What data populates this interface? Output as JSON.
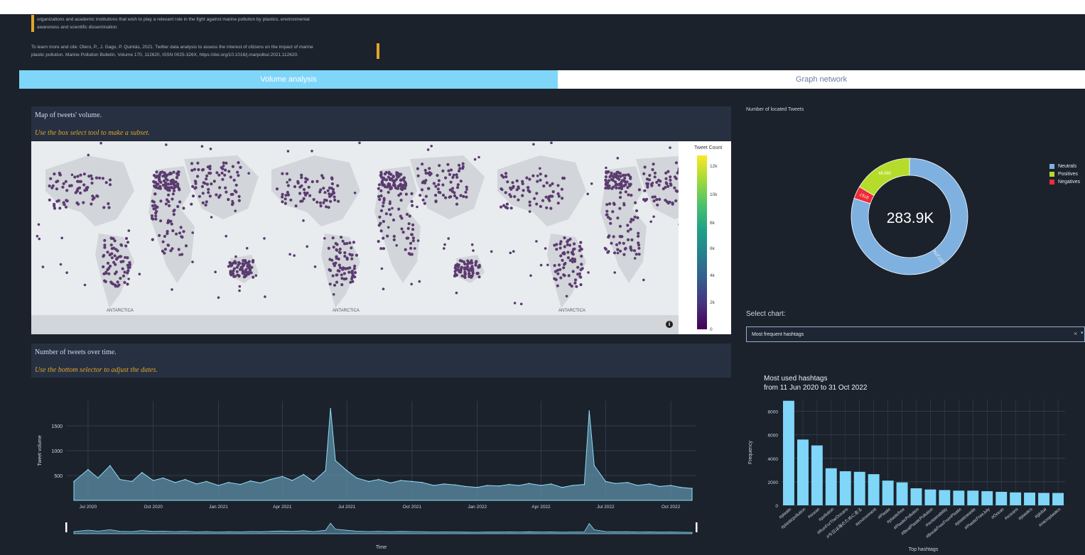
{
  "intro": {
    "line1": "organizations and academic institutions that wish to play a relevant role in the fight against marine pollution by plastics, environmental",
    "line2": "awareness and scientific dissemination.",
    "cite1": "To learn more and cite: Otero, P., J. Gago, P. Quintás, 2021. Twitter data analysis to assess the interest of citizens on the impact of marine",
    "cite2": "plastic pollution. Marine Pollution Bulletin, Volume 170, 112620, ISSN 0025-326X, https://doi.org/10.1016/j.marpolbul.2021.112620."
  },
  "tabs": [
    {
      "label": "Volume analysis",
      "active": true
    },
    {
      "label": "Graph network",
      "active": false
    }
  ],
  "map_card": {
    "title": "Map of tweets' volume.",
    "subtitle": "Use the box select tool to make a subset.",
    "antarctica_label": "ANTARCTICA",
    "colorbar": {
      "title": "Tweet Count",
      "ticks": [
        "12k",
        "10k",
        "8k",
        "6k",
        "4k",
        "2k",
        "0"
      ]
    },
    "info_icon": "info-icon"
  },
  "time_card": {
    "title": "Number of tweets over time.",
    "subtitle": "Use the bottom selector to adjust the dates."
  },
  "donut": {
    "title": "Number of located Tweets",
    "center_label": "283.9K",
    "segments": [
      {
        "name": "Neutrals",
        "value": 227274,
        "label": "227,274",
        "color": "#7fb1e0"
      },
      {
        "name": "Positives",
        "value": 46865,
        "label": "46,865",
        "color": "#b5dc2a"
      },
      {
        "name": "Negatives",
        "value": 9767,
        "label": "9767",
        "color": "#ee2b36"
      }
    ]
  },
  "select": {
    "label": "Select chart:",
    "value": "Most frequent hashtags",
    "clear_icon": "close-icon",
    "arrow_icon": "chevron-down-icon"
  },
  "accent_color": "#7fd6f8",
  "chart_data": [
    {
      "type": "area",
      "title": "",
      "xlabel": "Time",
      "ylabel": "Tweet volume",
      "ylim": [
        0,
        2000
      ],
      "yticks": [
        500,
        1000,
        1500
      ],
      "x_ticks": [
        "Jul 2020",
        "Oct 2020",
        "Jan 2021",
        "Apr 2021",
        "Jul 2021",
        "Oct 2021",
        "Jan 2022",
        "Apr 2022",
        "Jul 2022",
        "Oct 2022"
      ],
      "grid": true,
      "series": [
        {
          "x": [
            "2020-06-11",
            "2020-07-01",
            "2020-07-15",
            "2020-08-01",
            "2020-08-15",
            "2020-09-01",
            "2020-09-15",
            "2020-10-01",
            "2020-10-15",
            "2020-11-01",
            "2020-11-15",
            "2020-12-01",
            "2020-12-15",
            "2021-01-01",
            "2021-01-15",
            "2021-02-01",
            "2021-02-15",
            "2021-03-01",
            "2021-03-15",
            "2021-04-01",
            "2021-04-15",
            "2021-05-01",
            "2021-05-15",
            "2021-06-01",
            "2021-06-08",
            "2021-06-15",
            "2021-07-01",
            "2021-07-15",
            "2021-08-01",
            "2021-08-15",
            "2021-09-01",
            "2021-09-15",
            "2021-10-01",
            "2021-10-15",
            "2021-11-01",
            "2021-11-15",
            "2021-12-01",
            "2021-12-15",
            "2022-01-01",
            "2022-01-15",
            "2022-02-01",
            "2022-02-15",
            "2022-03-01",
            "2022-03-15",
            "2022-04-01",
            "2022-04-15",
            "2022-05-01",
            "2022-05-15",
            "2022-06-01",
            "2022-06-08",
            "2022-06-15",
            "2022-07-01",
            "2022-07-15",
            "2022-08-01",
            "2022-08-15",
            "2022-09-01",
            "2022-09-15",
            "2022-10-01",
            "2022-10-15",
            "2022-10-31"
          ],
          "values": [
            380,
            620,
            450,
            700,
            420,
            380,
            560,
            400,
            450,
            360,
            420,
            330,
            380,
            300,
            360,
            320,
            390,
            350,
            420,
            480,
            400,
            520,
            380,
            600,
            1850,
            800,
            600,
            450,
            380,
            420,
            350,
            400,
            380,
            360,
            300,
            330,
            310,
            280,
            260,
            300,
            290,
            320,
            300,
            340,
            300,
            330,
            260,
            300,
            320,
            1800,
            700,
            380,
            340,
            360,
            300,
            330,
            280,
            300,
            260,
            240
          ]
        }
      ]
    },
    {
      "type": "bar",
      "title": "Most used hashtags",
      "subtitle": "from 11 Jun 2020 to 31 Oct 2022",
      "xlabel": "Top hashtags",
      "ylabel": "Frequency",
      "ylim": [
        0,
        9000
      ],
      "yticks": [
        0,
        2000,
        4000,
        6000,
        8000
      ],
      "grid": true,
      "categories": [
        "#plastic",
        "#plasticpollution",
        "#ocean",
        "#pollution",
        "#RunForTheOceans",
        "#今日は海のために走る",
        "#environment",
        "#Plastic",
        "#plasticfree",
        "#PlasticPollution",
        "#BeatPlasticPollution",
        "#sustainability",
        "#BreakFreeFromPlastic",
        "#plasticwaste",
        "#PlasticFreeJuly",
        "#Ocean",
        "#oceans",
        "#plastics",
        "#global",
        "#microplastics"
      ],
      "values": [
        8900,
        5600,
        5100,
        3150,
        2900,
        2850,
        2650,
        2100,
        1950,
        1450,
        1350,
        1300,
        1250,
        1250,
        1200,
        1150,
        1100,
        1080,
        1060,
        1050
      ]
    }
  ]
}
